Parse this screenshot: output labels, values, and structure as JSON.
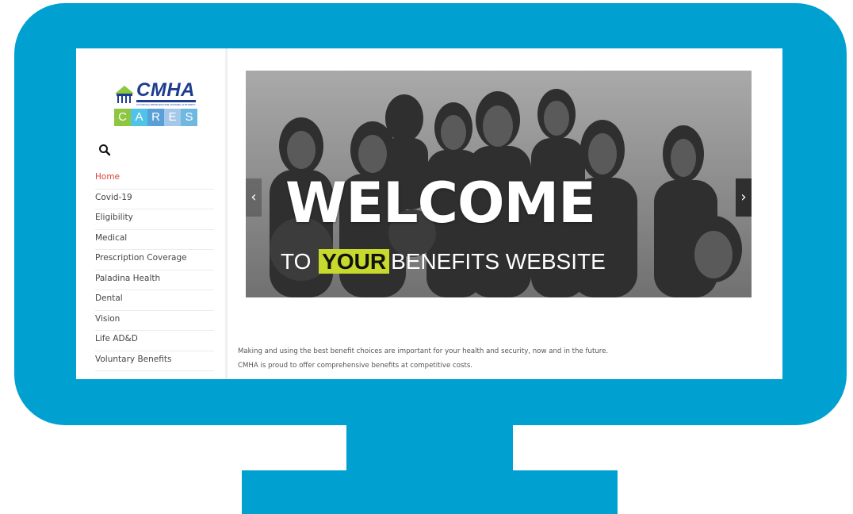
{
  "logo": {
    "name": "CMHA",
    "subtitle": "CUYAHOGA METROPOLITAN HOUSING AUTHORITY",
    "cares_letters": [
      "C",
      "A",
      "R",
      "E",
      "S"
    ],
    "cares_colors": [
      "#8dc63f",
      "#4fc3e8",
      "#5aa0d8",
      "#a5c8e8",
      "#6fb8e0"
    ],
    "brand_color": "#1e3d8f"
  },
  "search": {
    "icon": "search-icon"
  },
  "nav": {
    "items": [
      {
        "label": "Home",
        "active": true
      },
      {
        "label": "Covid-19"
      },
      {
        "label": "Eligibility"
      },
      {
        "label": "Medical"
      },
      {
        "label": "Prescription Coverage"
      },
      {
        "label": "Paladina Health"
      },
      {
        "label": "Dental"
      },
      {
        "label": "Vision"
      },
      {
        "label": "Life AD&D"
      },
      {
        "label": "Voluntary Benefits"
      }
    ],
    "active_color": "#d9453a"
  },
  "hero": {
    "headline": "WELCOME",
    "tagline_pre": "TO",
    "tagline_highlight": "YOUR",
    "tagline_post": "BENEFITS WEBSITE",
    "highlight_color": "#c6d92c",
    "prev_label": "‹",
    "next_label": "›"
  },
  "intro": {
    "line1": "Making and using the best benefit choices are important for your health and security, now and in the future.",
    "line2": "CMHA is proud to offer comprehensive benefits at competitive costs."
  },
  "colors": {
    "monitor": "#00a0d1"
  }
}
